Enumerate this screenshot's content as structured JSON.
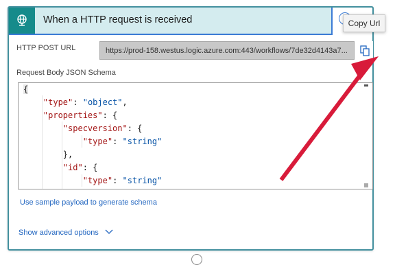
{
  "header": {
    "title": "When a HTTP request is received",
    "help_icon": "?",
    "tooltip": "Copy Url",
    "trigger_icon": "globe-icon"
  },
  "url": {
    "label": "HTTP POST URL",
    "value": "https://prod-158.westus.logic.azure.com:443/workflows/7de32d4143a7..."
  },
  "schema": {
    "label": "Request Body JSON Schema",
    "lines": [
      "{",
      "    \"type\": \"object\",",
      "    \"properties\": {",
      "        \"specversion\": {",
      "            \"type\": \"string\"",
      "        },",
      "        \"id\": {",
      "            \"type\": \"string\"",
      "        }"
    ]
  },
  "links": {
    "sample_payload": "Use sample payload to generate schema",
    "advanced": "Show advanced options"
  },
  "colors": {
    "header_bg": "#d4ecef",
    "icon_bg": "#168b8b",
    "card_border": "#43909e",
    "link": "#2266c0",
    "arrow": "#d81b3a"
  }
}
